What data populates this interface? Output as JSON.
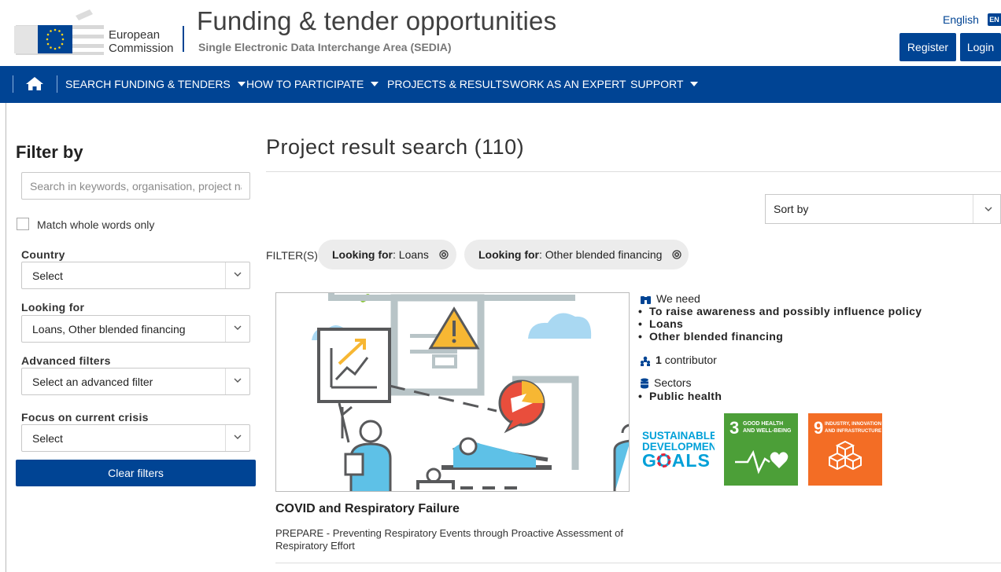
{
  "header": {
    "logo_line1": "European",
    "logo_line2": "Commission",
    "title": "Funding & tender opportunities",
    "subtitle": "Single Electronic Data Interchange Area (SEDIA)",
    "language": "English",
    "language_code": "EN",
    "register_label": "Register",
    "login_label": "Login"
  },
  "nav": {
    "items": [
      {
        "label": "SEARCH FUNDING & TENDERS",
        "dropdown": true
      },
      {
        "label": "HOW TO PARTICIPATE",
        "dropdown": true
      },
      {
        "label": "PROJECTS & RESULTS",
        "dropdown": false
      },
      {
        "label": "WORK AS AN EXPERT",
        "dropdown": false
      },
      {
        "label": "SUPPORT",
        "dropdown": true
      }
    ]
  },
  "sidebar": {
    "title": "Filter by",
    "search_placeholder": "Search in keywords, organisation, project name",
    "match_whole_words": "Match whole words only",
    "country": {
      "label": "Country",
      "value": "Select"
    },
    "looking_for": {
      "label": "Looking for",
      "value": "Loans, Other blended financing"
    },
    "advanced": {
      "label": "Advanced filters",
      "value": "Select an advanced filter"
    },
    "crisis": {
      "label": "Focus on current crisis",
      "value": "Select"
    },
    "clear_label": "Clear filters"
  },
  "main": {
    "title": "Project result search (110)",
    "sort_label": "Sort by",
    "filters_label": "FILTER(S):",
    "chips": [
      {
        "key": "Looking for",
        "value": ": Loans"
      },
      {
        "key": "Looking for",
        "value": ": Other blended financing"
      }
    ]
  },
  "result": {
    "we_need_label": "We need",
    "needs": [
      "To raise awareness and possibly influence policy",
      "Loans",
      "Other blended financing"
    ],
    "contributor_count": "1",
    "contributor_label": "contributor",
    "sectors_label": "Sectors",
    "sectors": [
      "Public health"
    ],
    "sdg_goals": {
      "line1": "SUSTAINABLE",
      "line2": "DEVELOPMENT",
      "line3": "GOALS"
    },
    "sdg3": {
      "number": "3",
      "text1": "GOOD HEALTH",
      "text2": "AND WELL-BEING"
    },
    "sdg9": {
      "number": "9",
      "text1": "INDUSTRY, INNOVATION",
      "text2": "AND INFRASTRUCTURE"
    },
    "title": "COVID and Respiratory Failure",
    "description": "PREPARE - Preventing Respiratory Events through Proactive Assessment of Respiratory Effort"
  },
  "colors": {
    "brand_blue": "#004494",
    "sdg3_green": "#4c9f38",
    "sdg9_orange": "#f36d25",
    "chip_bg": "#ececec"
  },
  "icons": [
    "home-icon",
    "chevron-down-icon",
    "close-circle-icon",
    "binoculars-icon",
    "people-icon",
    "database-icon",
    "eu-flag-icon"
  ]
}
